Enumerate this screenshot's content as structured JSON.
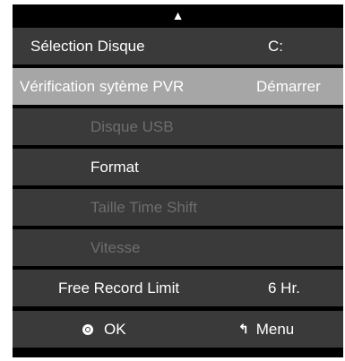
{
  "scroll_indicator": "▲",
  "menu": {
    "rows": [
      {
        "label": "Sélection Disque",
        "value": "C:"
      },
      {
        "label": "Vérification sytème PVR",
        "value": "Démarrer"
      },
      {
        "label": "Disque USB"
      },
      {
        "label": "Format"
      },
      {
        "label": "Taille Time Shift"
      },
      {
        "label": "Vitesse"
      },
      {
        "label": "Free Record Limit",
        "value": "6 Hr."
      }
    ]
  },
  "footer": {
    "ok_label": "OK",
    "menu_label": "Menu",
    "ok_icon": "ok-circle-icon",
    "back_icon": "return-arrow-icon"
  },
  "colors": {
    "background": "#000000",
    "row": "#3a3a3a",
    "selected_row": "#a6a6a6",
    "disabled_text": "#6e6e6e",
    "text": "#ffffff"
  }
}
